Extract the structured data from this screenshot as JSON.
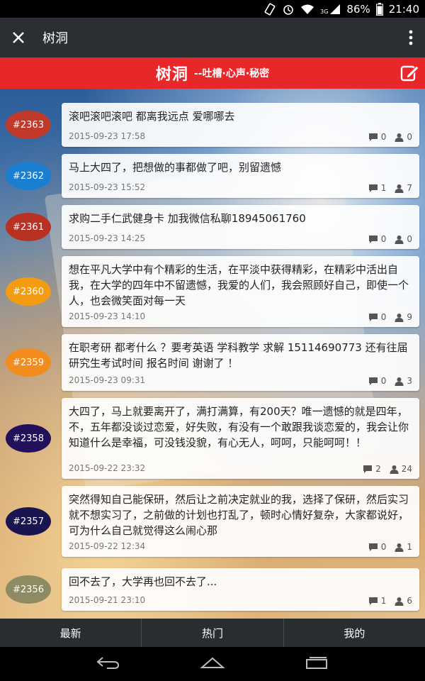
{
  "status_bar": {
    "battery": "86%",
    "time": "21:40",
    "network": "3G"
  },
  "title_bar": {
    "title": "树洞"
  },
  "header": {
    "brand": "树洞",
    "slogan": "--吐槽·心声·秘密"
  },
  "colors": {
    "header_red": "#e8272b",
    "title_bar": "#2b2f33",
    "tab_bar": "#2a2d30"
  },
  "posts": [
    {
      "id": "#2363",
      "badge_color": "#c0392b",
      "text": "滚吧滚吧滚吧 都离我远点 爱哪哪去",
      "time": "2015-09-23 17:58",
      "comments": "0",
      "likes": "0"
    },
    {
      "id": "#2362",
      "badge_color": "#1a7fd1",
      "text": "马上大四了，把想做的事都做了吧，别留遗憾",
      "time": "2015-09-23 15:52",
      "comments": "1",
      "likes": "7"
    },
    {
      "id": "#2361",
      "badge_color": "#b83224",
      "text": "求购二手仁武健身卡 加我微信私聊18945061760",
      "time": "2015-09-23 14:25",
      "comments": "0",
      "likes": "0"
    },
    {
      "id": "#2360",
      "badge_color": "#f39c12",
      "text": "想在平凡大学中有个精彩的生活，在平淡中获得精彩，在精彩中活出自我，在大学的四年中不留遗憾，我爱的人们，我会照顾好自己，即使一个人，也会微笑面对每一天",
      "time": "2015-09-23 14:10",
      "comments": "0",
      "likes": "9"
    },
    {
      "id": "#2359",
      "badge_color": "#f28c1c",
      "text": "在职考研 都考什么 ？要考英语 学科教学 求解 15114690773 还有往届研究生考试时间 报名时间 谢谢了 ！",
      "time": "2015-09-23 09:31",
      "comments": "0",
      "likes": "3"
    },
    {
      "id": "#2358",
      "badge_color": "#23105a",
      "text": "大四了，马上就要离开了，满打满算，有200天？唯一遗憾的就是四年，不，五年都没谈过恋爱，好失败，有没有一个敢跟我谈恋爱的，我会让你知道什么是幸福，可没钱没貌，有心无人，呵呵，只能呵呵！！",
      "time": "2015-09-22 23:32",
      "comments": "2",
      "likes": "24"
    },
    {
      "id": "#2357",
      "badge_color": "#1a1450",
      "text": "突然得知自己能保研，然后让之前决定就业的我，选择了保研，然后实习就不想实习了，之前做的计划也打乱了，顿时心情好复杂，大家都说好，可为什么自己就觉得这么闹心那",
      "time": "2015-09-22 12:34",
      "comments": "0",
      "likes": "1"
    },
    {
      "id": "#2356",
      "badge_color": "#8e8a64",
      "text": "回不去了，大学再也回不去了...",
      "time": "2015-09-21 23:10",
      "comments": "1",
      "likes": "6"
    }
  ],
  "tabs": [
    {
      "label": "最新"
    },
    {
      "label": "热门"
    },
    {
      "label": "我的"
    }
  ]
}
